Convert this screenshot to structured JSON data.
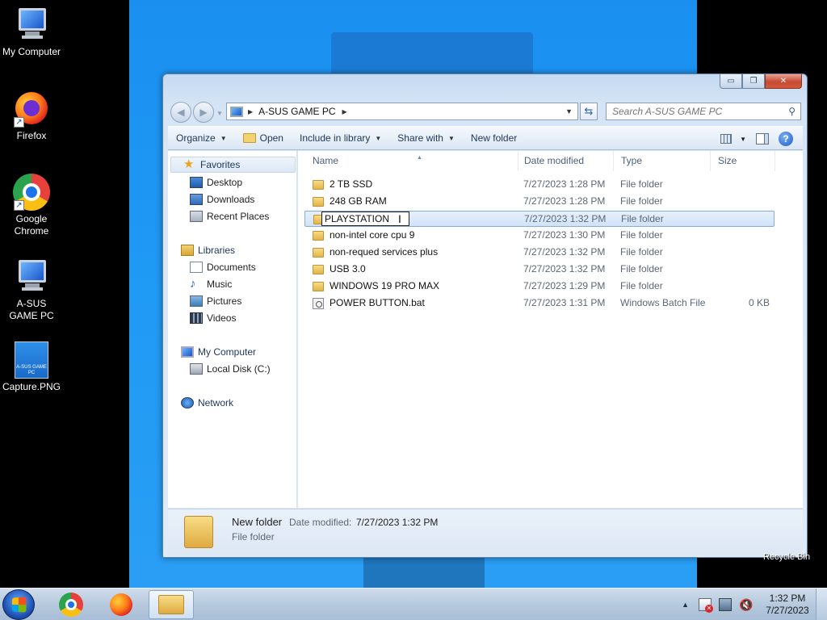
{
  "desktop": {
    "icons": [
      {
        "label": "My Computer",
        "icon": "computer-icon"
      },
      {
        "label": "Firefox",
        "icon": "firefox-icon"
      },
      {
        "label": "Google Chrome",
        "icon": "chrome-icon"
      },
      {
        "label": "A-SUS GAME PC",
        "icon": "computer-icon"
      },
      {
        "label": "Capture.PNG",
        "icon": "image-file-icon"
      }
    ],
    "png_thumb_text": "A-SUS GAME PC",
    "recycle_bin_label": "Recycle Bin"
  },
  "window": {
    "caption_buttons": {
      "minimize": "▭",
      "maximize": "❐",
      "close": "✕"
    },
    "address": {
      "crumbs": [
        "A-SUS GAME PC"
      ]
    },
    "search": {
      "placeholder": "Search A-SUS GAME PC"
    },
    "toolbar": {
      "organize": "Organize",
      "open": "Open",
      "include_in_library": "Include in library",
      "share_with": "Share with",
      "new_folder": "New folder",
      "help": "?"
    },
    "nav": {
      "favorites": {
        "label": "Favorites",
        "items": [
          "Desktop",
          "Downloads",
          "Recent Places"
        ]
      },
      "libraries": {
        "label": "Libraries",
        "items": [
          "Documents",
          "Music",
          "Pictures",
          "Videos"
        ]
      },
      "computer": {
        "label": "My Computer",
        "items": [
          "Local Disk (C:)"
        ]
      },
      "network": {
        "label": "Network"
      }
    },
    "columns": {
      "name": "Name",
      "date": "Date modified",
      "type": "Type",
      "size": "Size"
    },
    "files": [
      {
        "name": "2 TB SSD",
        "date": "7/27/2023 1:28 PM",
        "type": "File folder",
        "size": "",
        "kind": "folder"
      },
      {
        "name": "248 GB RAM",
        "date": "7/27/2023 1:28 PM",
        "type": "File folder",
        "size": "",
        "kind": "folder"
      },
      {
        "name": "PLAYSTATION ",
        "date": "7/27/2023 1:32 PM",
        "type": "File folder",
        "size": "",
        "kind": "folder",
        "renaming": true
      },
      {
        "name": "non-intel core cpu 9",
        "date": "7/27/2023 1:30 PM",
        "type": "File folder",
        "size": "",
        "kind": "folder"
      },
      {
        "name": "non-requed services plus",
        "date": "7/27/2023 1:32 PM",
        "type": "File folder",
        "size": "",
        "kind": "folder"
      },
      {
        "name": "USB 3.0",
        "date": "7/27/2023 1:32 PM",
        "type": "File folder",
        "size": "",
        "kind": "folder"
      },
      {
        "name": "WINDOWS 19 PRO MAX",
        "date": "7/27/2023 1:29 PM",
        "type": "File folder",
        "size": "",
        "kind": "folder"
      },
      {
        "name": "POWER BUTTON.bat",
        "date": "7/27/2023 1:31 PM",
        "type": "Windows Batch File",
        "size": "0 KB",
        "kind": "batch"
      }
    ],
    "details": {
      "name": "New folder",
      "modified_label": "Date modified:",
      "modified_value": "7/27/2023 1:32 PM",
      "type": "File folder"
    }
  },
  "taskbar": {
    "clock_time": "1:32 PM",
    "clock_date": "7/27/2023"
  }
}
